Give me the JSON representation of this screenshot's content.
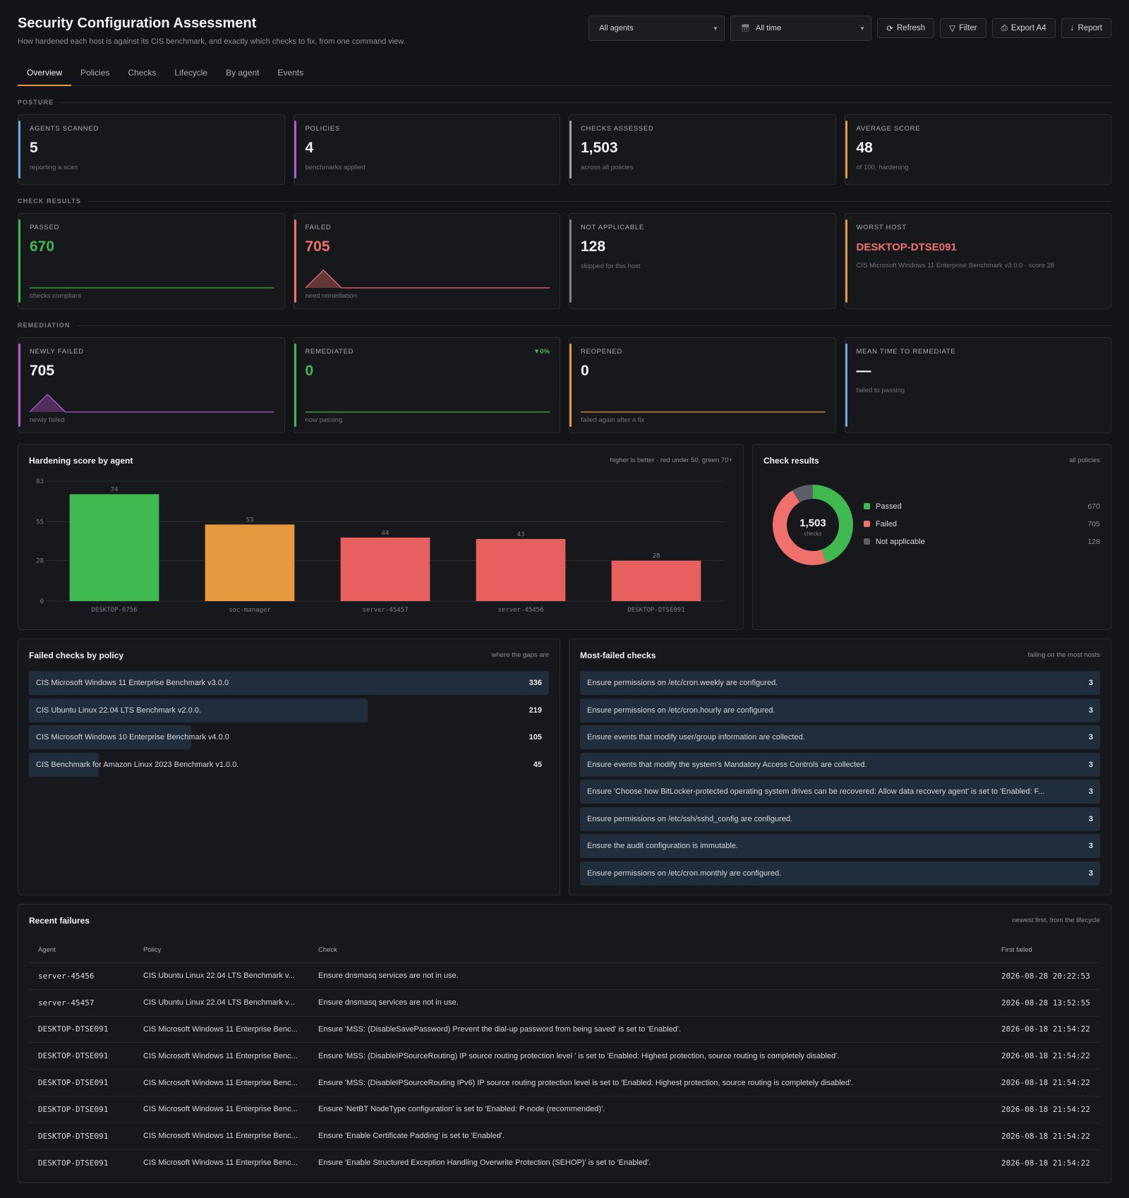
{
  "header": {
    "title": "Security Configuration Assessment",
    "subtitle": "How hardened each host is against its CIS benchmark, and exactly which checks to fix, from one command view.",
    "agent_select": "All agents",
    "time_select": "All time",
    "buttons": {
      "refresh": "Refresh",
      "filter": "Filter",
      "export": "Export A4",
      "report": "Report"
    }
  },
  "tabs": [
    "Overview",
    "Policies",
    "Checks",
    "Lifecycle",
    "By agent",
    "Events"
  ],
  "sections": {
    "posture": "POSTURE",
    "check_results": "CHECK RESULTS",
    "remediation": "REMEDIATION"
  },
  "posture": [
    {
      "label": "AGENTS SCANNED",
      "value": "5",
      "sub": "reporting a scan",
      "color": "#6ea8dc"
    },
    {
      "label": "POLICIES",
      "value": "4",
      "sub": "benchmarks applied",
      "color": "#b659d1"
    },
    {
      "label": "CHECKS ASSESSED",
      "value": "1,503",
      "sub": "across all policies",
      "color": "#9ea1a8"
    },
    {
      "label": "AVERAGE SCORE",
      "value": "48",
      "sub": "of 100, hardening",
      "color": "#e79a3d"
    }
  ],
  "results": {
    "passed": {
      "label": "PASSED",
      "value": "670",
      "sub": "checks compliant",
      "color": "#3fb950"
    },
    "failed": {
      "label": "FAILED",
      "value": "705",
      "sub": "need remediation",
      "color": "#f0706e"
    },
    "na": {
      "label": "NOT APPLICABLE",
      "value": "128",
      "sub": "skipped for this host",
      "color": "#7d8087"
    },
    "worst": {
      "label": "WORST HOST",
      "value": "DESKTOP-DTSE091",
      "sub": "CIS Microsoft Windows 11 Enterprise Benchmark v3.0.0 · score 28",
      "color": "#e79a3d"
    }
  },
  "remediation": {
    "newly": {
      "label": "NEWLY FAILED",
      "value": "705",
      "sub": "newly failed",
      "color": "#b659d1"
    },
    "remediated": {
      "label": "REMEDIATED",
      "value": "0",
      "sub": "now passing",
      "delta": "▼0%",
      "color": "#3fb950"
    },
    "reopened": {
      "label": "REOPENED",
      "value": "0",
      "sub": "failed again after a fix",
      "color": "#e79a3d"
    },
    "mttr": {
      "label": "MEAN TIME TO REMEDIATE",
      "value": "—",
      "sub": "failed to passing",
      "color": "#6ea8dc"
    }
  },
  "score_panel": {
    "title": "Hardening score by agent",
    "hint": "higher is better · red under 50, green 70+"
  },
  "donut_panel": {
    "title": "Check results",
    "hint": "all policies",
    "center_value": "1,503",
    "center_label": "checks",
    "legend": [
      {
        "name": "Passed",
        "value": "670",
        "color": "#3fb950"
      },
      {
        "name": "Failed",
        "value": "705",
        "color": "#f0706e"
      },
      {
        "name": "Not applicable",
        "value": "128",
        "color": "#5c5f66"
      }
    ]
  },
  "chart_data": [
    {
      "type": "bar",
      "title": "Hardening score by agent",
      "categories": [
        "DESKTOP-6756",
        "soc-manager",
        "server-45457",
        "server-45456",
        "DESKTOP-DTSE091"
      ],
      "values": [
        74,
        53,
        44,
        43,
        28
      ],
      "colors": [
        "#3fb950",
        "#e79a3d",
        "#e5605f",
        "#e5605f",
        "#e5605f"
      ],
      "yticks": [
        0,
        28,
        55,
        83
      ],
      "ylim": [
        0,
        83
      ],
      "grid": true
    },
    {
      "type": "pie",
      "title": "Check results",
      "categories": [
        "Passed",
        "Failed",
        "Not applicable"
      ],
      "values": [
        670,
        705,
        128
      ],
      "colors": [
        "#3fb950",
        "#f0706e",
        "#5c5f66"
      ]
    }
  ],
  "policy_panel": {
    "title": "Failed checks by policy",
    "hint": "where the gaps are",
    "items": [
      {
        "label": "CIS Microsoft Windows 11 Enterprise Benchmark v3.0.0",
        "value": 336
      },
      {
        "label": "CIS Ubuntu Linux 22.04 LTS Benchmark v2.0.0.",
        "value": 219
      },
      {
        "label": "CIS Microsoft Windows 10 Enterprise Benchmark v4.0.0",
        "value": 105
      },
      {
        "label": "CIS Benchmark for Amazon Linux 2023 Benchmark v1.0.0.",
        "value": 45
      }
    ]
  },
  "mostfailed_panel": {
    "title": "Most-failed checks",
    "hint": "failing on the most hosts",
    "items": [
      {
        "label": "Ensure permissions on /etc/cron.weekly are configured.",
        "value": 3
      },
      {
        "label": "Ensure permissions on /etc/cron.hourly are configured.",
        "value": 3
      },
      {
        "label": "Ensure events that modify user/group information are collected.",
        "value": 3
      },
      {
        "label": "Ensure events that modify the system's Mandatory Access Controls are collected.",
        "value": 3
      },
      {
        "label": "Ensure 'Choose how BitLocker-protected operating system drives can be recovered: Allow data recovery agent' is set to 'Enabled: F...",
        "value": 3
      },
      {
        "label": "Ensure permissions on /etc/ssh/sshd_config are configured.",
        "value": 3
      },
      {
        "label": "Ensure the audit configuration is immutable.",
        "value": 3
      },
      {
        "label": "Ensure permissions on /etc/cron.monthly are configured.",
        "value": 3
      }
    ]
  },
  "recent": {
    "title": "Recent failures",
    "hint": "newest first, from the lifecycle",
    "columns": [
      "Agent",
      "Policy",
      "Check",
      "First failed"
    ],
    "rows": [
      [
        "server-45456",
        "CIS Ubuntu Linux 22.04 LTS Benchmark v...",
        "Ensure dnsmasq services are not in use.",
        "2026-08-28 20:22:53"
      ],
      [
        "server-45457",
        "CIS Ubuntu Linux 22.04 LTS Benchmark v...",
        "Ensure dnsmasq services are not in use.",
        "2026-08-28 13:52:55"
      ],
      [
        "DESKTOP-DTSE091",
        "CIS Microsoft Windows 11 Enterprise Benc...",
        "Ensure 'MSS: (DisableSavePassword) Prevent the dial-up password from being saved' is set to 'Enabled'.",
        "2026-08-18 21:54:22"
      ],
      [
        "DESKTOP-DTSE091",
        "CIS Microsoft Windows 11 Enterprise Benc...",
        "Ensure 'MSS: (DisableIPSourceRouting) IP source routing protection level ' is set to 'Enabled: Highest protection, source routing is completely disabled'.",
        "2026-08-18 21:54:22"
      ],
      [
        "DESKTOP-DTSE091",
        "CIS Microsoft Windows 11 Enterprise Benc...",
        "Ensure 'MSS: (DisableIPSourceRouting IPv6) IP source routing protection level is set to 'Enabled: Highest protection, source routing is completely disabled'.",
        "2026-08-18 21:54:22"
      ],
      [
        "DESKTOP-DTSE091",
        "CIS Microsoft Windows 11 Enterprise Benc...",
        "Ensure 'NetBT NodeType configuration' is set to 'Enabled: P-node (recommended)'.",
        "2026-08-18 21:54:22"
      ],
      [
        "DESKTOP-DTSE091",
        "CIS Microsoft Windows 11 Enterprise Benc...",
        "Ensure 'Enable Certificate Padding' is set to 'Enabled'.",
        "2026-08-18 21:54:22"
      ],
      [
        "DESKTOP-DTSE091",
        "CIS Microsoft Windows 11 Enterprise Benc...",
        "Ensure 'Enable Structured Exception Handling Overwrite Protection (SEHOP)' is set to 'Enabled'.",
        "2026-08-18 21:54:22"
      ]
    ]
  }
}
